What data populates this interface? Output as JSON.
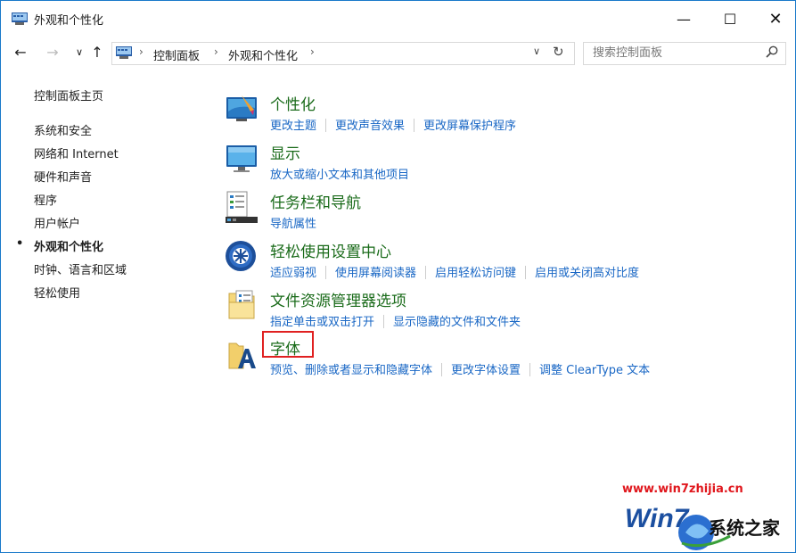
{
  "window": {
    "title": "外观和个性化",
    "minimize_glyph": "—",
    "maximize_glyph": "☐",
    "close_glyph": "✕"
  },
  "nav": {
    "back_glyph": "←",
    "forward_glyph": "→",
    "recent_glyph": "∨",
    "up_glyph": "↑",
    "breadcrumb": [
      "控制面板",
      "外观和个性化"
    ],
    "crumb_sep": "›",
    "dropdown_glyph": "∨",
    "refresh_glyph": "↻"
  },
  "search": {
    "placeholder": "搜索控制面板",
    "icon": "search-icon"
  },
  "sidebar": {
    "items": [
      {
        "label": "控制面板主页"
      },
      {
        "label": "系统和安全"
      },
      {
        "label": "网络和 Internet"
      },
      {
        "label": "硬件和声音"
      },
      {
        "label": "程序"
      },
      {
        "label": "用户帐户"
      },
      {
        "label": "外观和个性化",
        "active": true
      },
      {
        "label": "时钟、语言和区域"
      },
      {
        "label": "轻松使用"
      }
    ],
    "bullet": "•"
  },
  "categories": [
    {
      "title": "个性化",
      "icon": "personalization-icon",
      "links": [
        "更改主题",
        "更改声音效果",
        "更改屏幕保护程序"
      ]
    },
    {
      "title": "显示",
      "icon": "display-icon",
      "links": [
        "放大或缩小文本和其他项目"
      ]
    },
    {
      "title": "任务栏和导航",
      "icon": "taskbar-icon",
      "links": [
        "导航属性"
      ]
    },
    {
      "title": "轻松使用设置中心",
      "icon": "ease-of-access-icon",
      "links": [
        "适应弱视",
        "使用屏幕阅读器",
        "启用轻松访问键",
        "启用或关闭高对比度"
      ]
    },
    {
      "title": "文件资源管理器选项",
      "icon": "folder-options-icon",
      "links": [
        "指定单击或双击打开",
        "显示隐藏的文件和文件夹"
      ]
    },
    {
      "title": "字体",
      "icon": "fonts-icon",
      "links": [
        "预览、删除或者显示和隐藏字体",
        "更改字体设置",
        "调整 ClearType 文本"
      ]
    }
  ],
  "watermark": {
    "url": "www.win7zhijia.cn",
    "brand": "系统之家",
    "logo_text": "Win7"
  },
  "colors": {
    "accent_border": "#1979ca",
    "category_title": "#1a6b1a",
    "link": "#1967c5",
    "highlight": "#e02020"
  }
}
